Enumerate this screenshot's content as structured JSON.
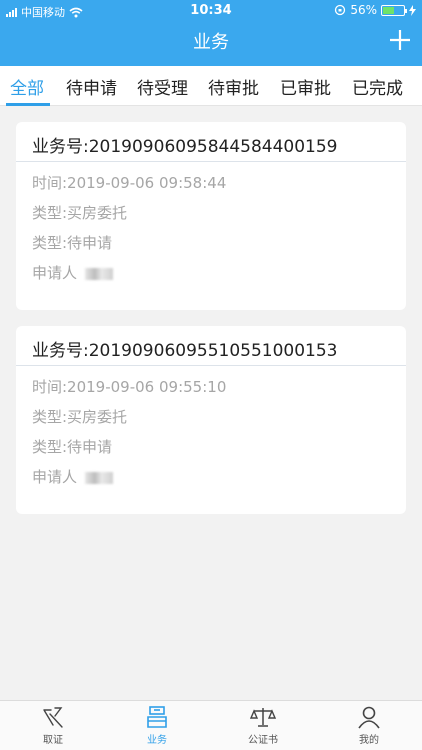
{
  "status_bar": {
    "carrier": "中国移动",
    "time": "10:34",
    "battery": "56%",
    "battery_level": 0.56
  },
  "header": {
    "title": "业务",
    "add_icon": "plus-icon"
  },
  "tabs": [
    {
      "label": "全部",
      "active": true
    },
    {
      "label": "待申请"
    },
    {
      "label": "待受理"
    },
    {
      "label": "待审批"
    },
    {
      "label": "已审批"
    },
    {
      "label": "已完成"
    }
  ],
  "records": [
    {
      "number": "业务号:20190906095844584400159",
      "time": "时间:2019-09-06 09:58:44",
      "type": "类型:买房委托",
      "status": "类型:待申请",
      "applicant_label": "申请人"
    },
    {
      "number": "业务号:20190906095510551000153",
      "time": "时间:2019-09-06 09:55:10",
      "type": "类型:买房委托",
      "status": "类型:待申请",
      "applicant_label": "申请人"
    }
  ],
  "bottom_nav": [
    {
      "label": "取证",
      "icon": "evidence-icon"
    },
    {
      "label": "业务",
      "icon": "business-icon",
      "active": true
    },
    {
      "label": "公证书",
      "icon": "scales-icon"
    },
    {
      "label": "我的",
      "icon": "person-icon"
    }
  ],
  "colors": {
    "accent": "#3aa8ee",
    "active_tab": "#2f9fe8",
    "muted_text": "#a6a6a6"
  }
}
